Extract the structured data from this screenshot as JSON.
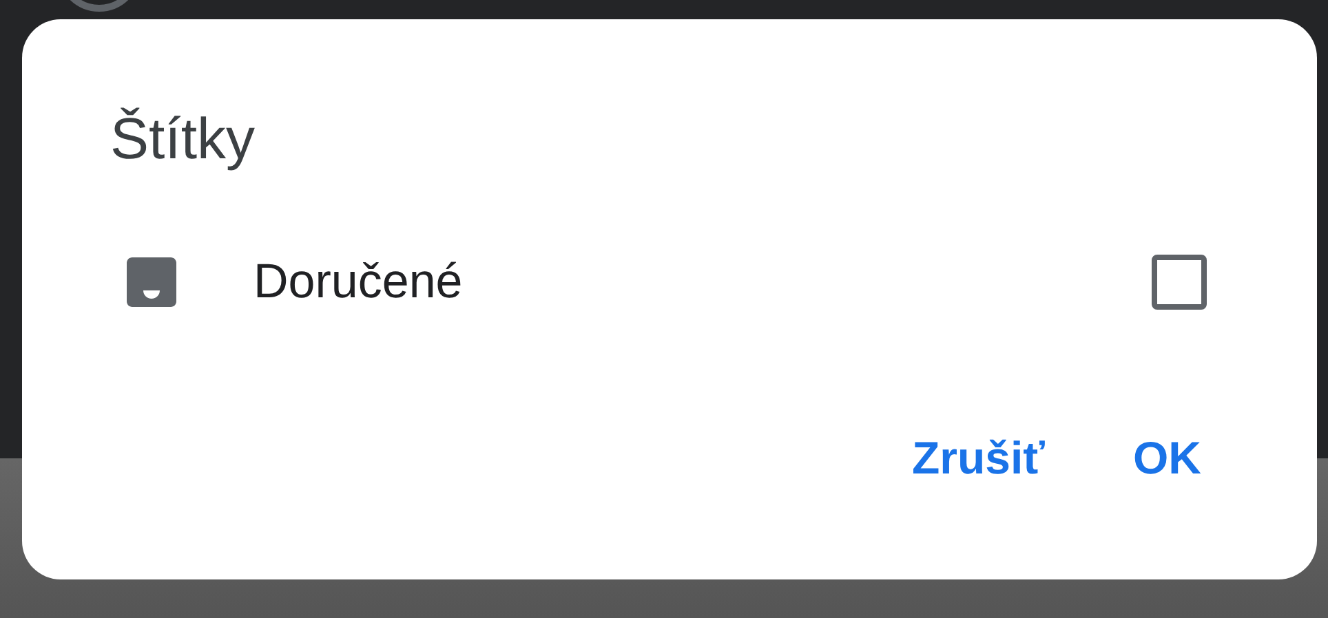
{
  "dialog": {
    "title": "Štítky",
    "labels": [
      {
        "name": "Doručené",
        "checked": false
      }
    ],
    "buttons": [
      "Zrušiť",
      "OK"
    ]
  }
}
